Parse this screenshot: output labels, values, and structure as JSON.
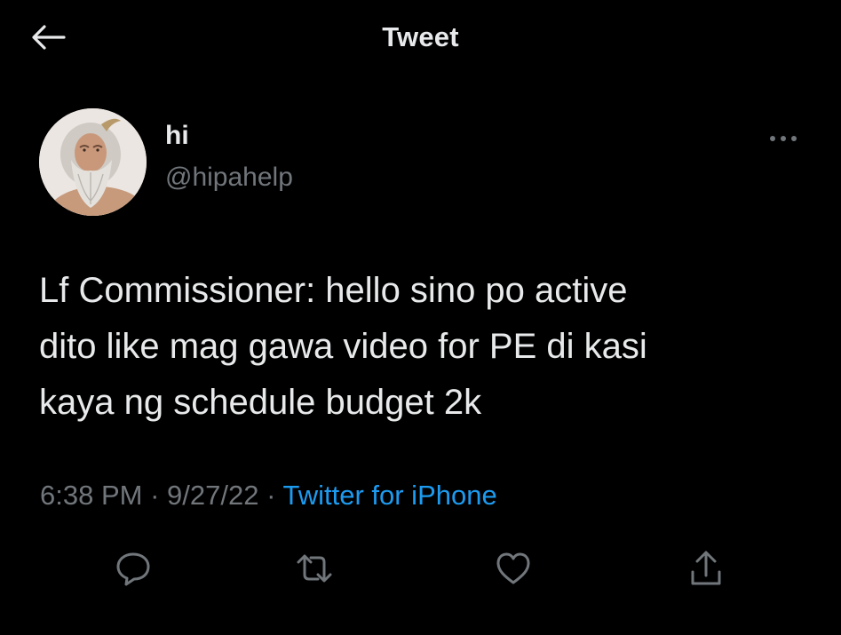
{
  "header": {
    "title": "Tweet",
    "back_icon": "arrow-left-icon"
  },
  "author": {
    "display_name": "hi",
    "handle": "@hipahelp",
    "avatar": "avatar-image"
  },
  "tweet": {
    "text": "Lf Commissioner: hello sino po active\ndito like mag gawa video for PE di kasi\nkaya ng schedule budget 2k",
    "time": "6:38 PM",
    "date": "9/27/22",
    "separator": "·",
    "source": "Twitter for iPhone"
  },
  "actions": {
    "reply_icon": "reply-icon",
    "retweet_icon": "retweet-icon",
    "like_icon": "heart-icon",
    "share_icon": "share-icon"
  },
  "colors": {
    "background": "#000000",
    "text_primary": "#e7e9ea",
    "text_secondary": "#71767b",
    "accent": "#1d9bf0"
  }
}
